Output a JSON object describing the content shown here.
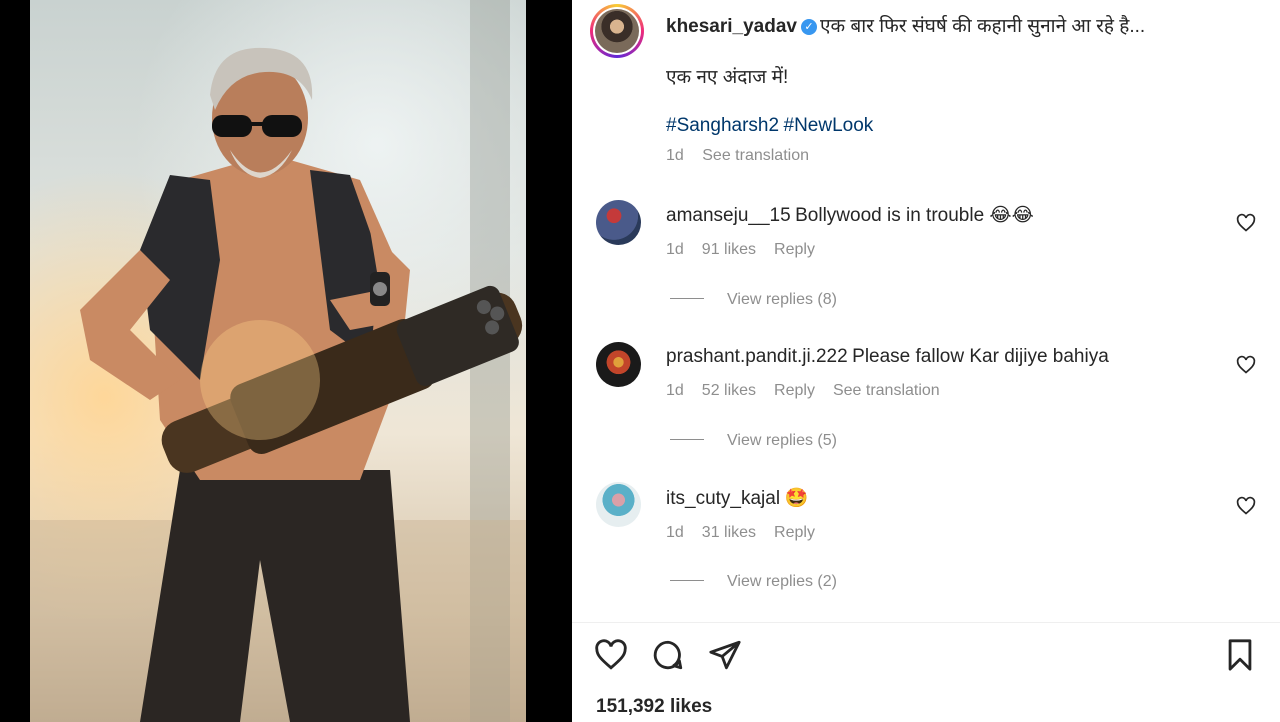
{
  "post": {
    "author": "khesari_yadav",
    "verified_mark": "✓",
    "caption_line1": "एक बार फिर संघर्ष की कहानी सुनाने आ रहे है...",
    "caption_line2": "एक नए अंदाज में!",
    "hashtags": [
      "#Sanghars h2",
      "#NewLook"
    ],
    "hashtag1": "#Sangharsh2",
    "hashtag2": "#NewLook",
    "age": "1d",
    "see_translation": "See translation",
    "likes": "151,392 likes"
  },
  "comments": [
    {
      "username": "amanseju__15",
      "text": "Bollywood is in trouble 😂😂",
      "age": "1d",
      "likes": "91 likes",
      "reply": "Reply",
      "view_replies": "View replies (8)"
    },
    {
      "username": "prashant.pandit.ji.222",
      "text": "Please fallow Kar dijiye bahiya",
      "age": "1d",
      "likes": "52 likes",
      "reply": "Reply",
      "see_translation": "See translation",
      "view_replies": "View replies (5)"
    },
    {
      "username": "its_cuty_kajal",
      "text": "🤩",
      "age": "1d",
      "likes": "31 likes",
      "reply": "Reply",
      "view_replies": "View replies (2)"
    }
  ],
  "icons": {
    "like": "heart-icon",
    "comment": "comment-icon",
    "share": "share-icon",
    "save": "bookmark-icon"
  },
  "colors": {
    "link": "#00376b",
    "meta": "#8e8e8e",
    "verified": "#3897f0"
  }
}
